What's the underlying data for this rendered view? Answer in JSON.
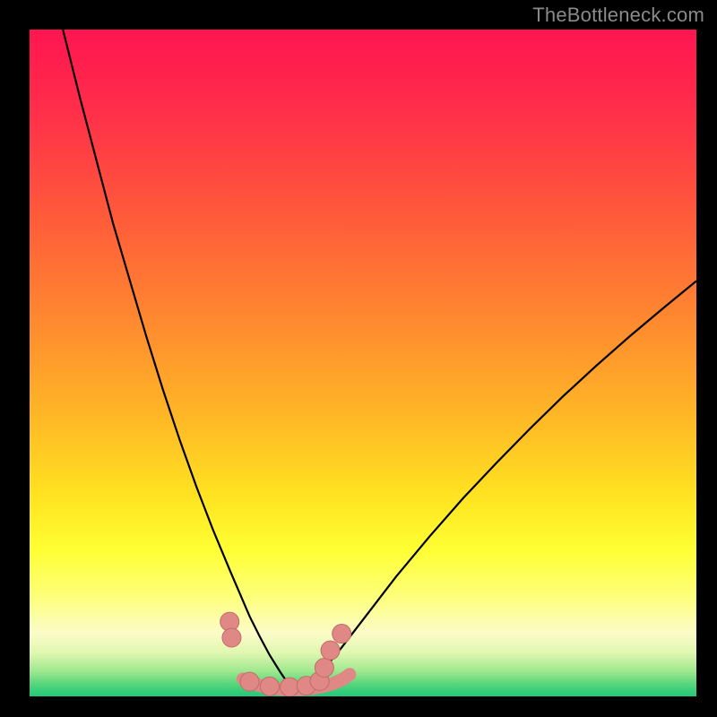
{
  "watermark": "TheBottleneck.com",
  "colors": {
    "frame": "#000000",
    "curve": "#000000",
    "marker_fill": "#e08885",
    "marker_stroke": "#c36b6a",
    "gradient_stops": [
      {
        "offset": 0.0,
        "color": "#ff1550"
      },
      {
        "offset": 0.12,
        "color": "#ff2e4a"
      },
      {
        "offset": 0.28,
        "color": "#ff5a3a"
      },
      {
        "offset": 0.44,
        "color": "#ff8a2f"
      },
      {
        "offset": 0.58,
        "color": "#ffb726"
      },
      {
        "offset": 0.7,
        "color": "#ffe321"
      },
      {
        "offset": 0.78,
        "color": "#ffff33"
      },
      {
        "offset": 0.85,
        "color": "#fdff7a"
      },
      {
        "offset": 0.905,
        "color": "#fcfcc8"
      },
      {
        "offset": 0.935,
        "color": "#dff7b0"
      },
      {
        "offset": 0.962,
        "color": "#9fe88e"
      },
      {
        "offset": 0.984,
        "color": "#4fd37a"
      },
      {
        "offset": 1.0,
        "color": "#20c97a"
      }
    ]
  },
  "chart_data": {
    "type": "line",
    "title": "",
    "xlabel": "",
    "ylabel": "",
    "xlim": [
      0,
      100
    ],
    "ylim": [
      0,
      100
    ],
    "series": [
      {
        "name": "left-curve",
        "x": [
          5,
          7.5,
          10,
          12.5,
          15,
          17.5,
          20,
          22.5,
          25,
          27.5,
          30,
          31.5,
          33,
          34.5,
          36,
          37.5,
          38.5,
          39.5
        ],
        "values": [
          100,
          90,
          80.5,
          71,
          62.5,
          54,
          46,
          38.5,
          31.5,
          25,
          19,
          15.5,
          12,
          9,
          6.2,
          3.8,
          2.3,
          1.1
        ]
      },
      {
        "name": "right-curve",
        "x": [
          40.5,
          42,
          44,
          46,
          48,
          51,
          55,
          60,
          65,
          70,
          75,
          80,
          85,
          90,
          95,
          100
        ],
        "values": [
          1.1,
          2.1,
          4,
          6.3,
          8.9,
          12.8,
          18,
          24,
          29.7,
          35,
          40.1,
          45,
          49.6,
          54,
          58.2,
          62.3
        ]
      },
      {
        "name": "valley-floor",
        "x": [
          32,
          33.5,
          35,
          36.5,
          38,
          39.5,
          41,
          42.5,
          44,
          45.5,
          47,
          48
        ],
        "values": [
          2.6,
          1.9,
          1.5,
          1.2,
          1.05,
          1.0,
          1.05,
          1.2,
          1.5,
          1.9,
          2.6,
          3.3
        ]
      }
    ],
    "markers": {
      "name": "marker-points",
      "x": [
        30.0,
        30.3,
        33.0,
        36.0,
        39.0,
        41.5,
        43.5,
        44.2,
        45.1,
        46.8
      ],
      "values": [
        11.2,
        8.8,
        2.2,
        1.5,
        1.4,
        1.6,
        2.3,
        4.3,
        6.9,
        9.4
      ]
    }
  }
}
